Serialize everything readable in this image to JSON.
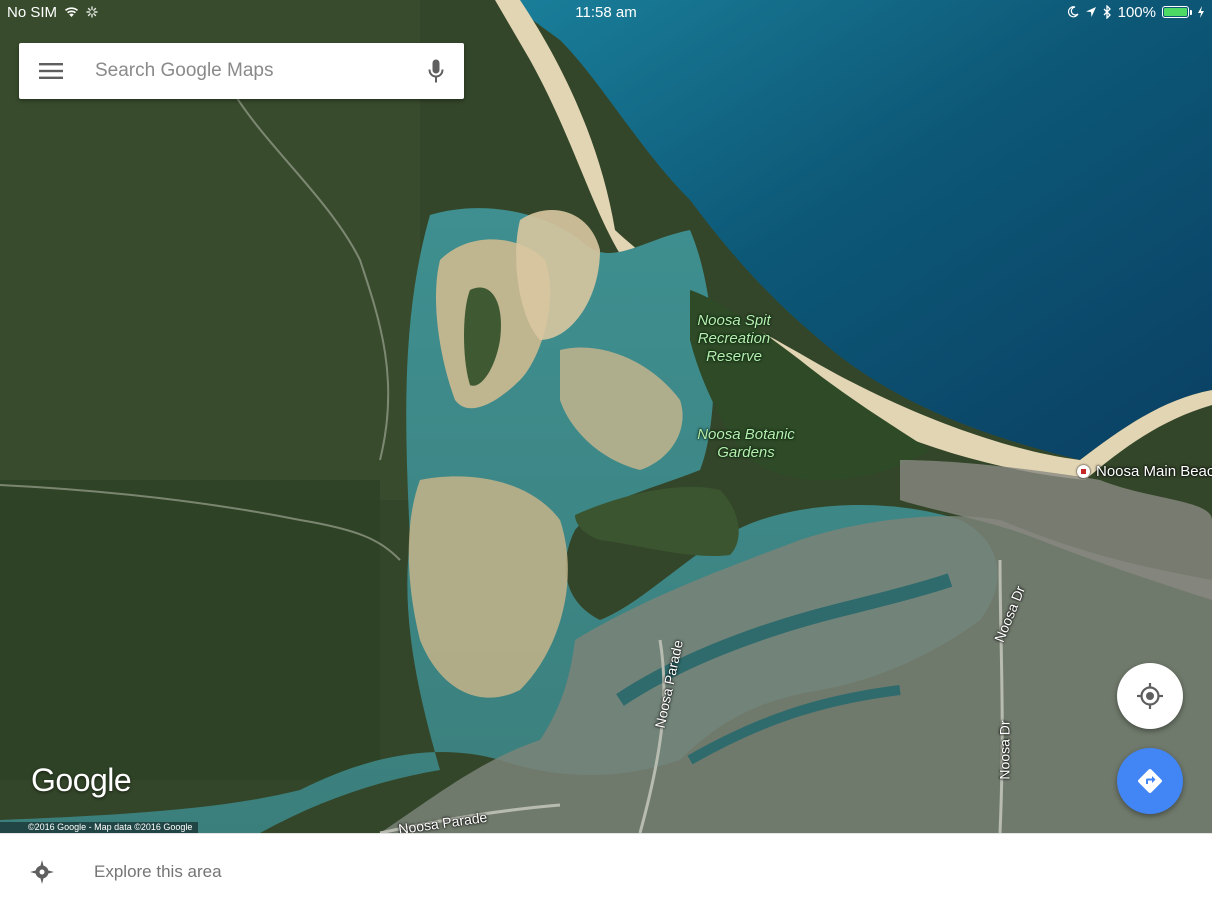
{
  "status_bar": {
    "carrier": "No SIM",
    "time": "11:58 am",
    "battery_percent": "100%",
    "battery_level": 1.0,
    "icons": [
      "wifi-icon",
      "activity-spinner-icon",
      "moon-icon",
      "location-arrow-icon",
      "bluetooth-icon",
      "battery-icon",
      "charging-icon"
    ]
  },
  "search": {
    "placeholder": "Search Google Maps",
    "menu_icon": "hamburger-menu-icon",
    "mic_icon": "microphone-icon"
  },
  "map": {
    "places": {
      "spit_reserve": "Noosa Spit Recreation Reserve",
      "botanic_gardens": "Noosa Botanic Gardens",
      "main_beach": "Noosa Main Beac"
    },
    "roads": {
      "noosa_parade_vertical": "Noosa Parade",
      "noosa_dr_1": "Noosa Dr",
      "noosa_dr_2": "Noosa Dr",
      "noosa_parade_horizontal": "Noosa Parade"
    },
    "logo": "Google",
    "copyright": "©2016 Google - Map data ©2016 Google",
    "colors": {
      "ocean": "#0f5f7a",
      "sand": "#d9c7a0",
      "forest": "#33492a",
      "river": "#4d8a8a"
    }
  },
  "fabs": {
    "my_location_icon": "my-location-icon",
    "directions_icon": "directions-icon",
    "directions_color": "#4285f4"
  },
  "bottom_bar": {
    "explore_label": "Explore this area",
    "explore_icon": "explore-compass-icon"
  }
}
